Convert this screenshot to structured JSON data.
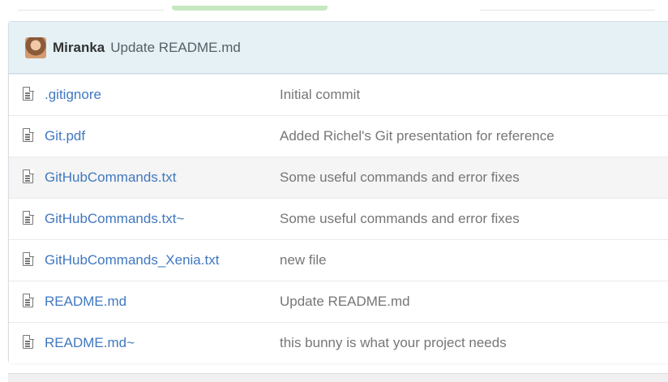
{
  "latest_commit": {
    "author": "Miranka",
    "message": "Update README.md"
  },
  "files": [
    {
      "name": ".gitignore",
      "commit": "Initial commit"
    },
    {
      "name": "Git.pdf",
      "commit": "Added Richel's Git presentation for reference"
    },
    {
      "name": "GitHubCommands.txt",
      "commit": "Some useful commands and error fixes"
    },
    {
      "name": "GitHubCommands.txt~",
      "commit": "Some useful commands and error fixes"
    },
    {
      "name": "GitHubCommands_Xenia.txt",
      "commit": "new file"
    },
    {
      "name": "README.md",
      "commit": "Update README.md"
    },
    {
      "name": "README.md~",
      "commit": "this bunny is what your project needs"
    }
  ],
  "icons": {
    "file": "file-text-icon",
    "avatar": "user-avatar"
  },
  "colors": {
    "link": "#4078c0",
    "header_bg": "#e6f1f6",
    "row_hover_bg": "#f5f5f5"
  }
}
